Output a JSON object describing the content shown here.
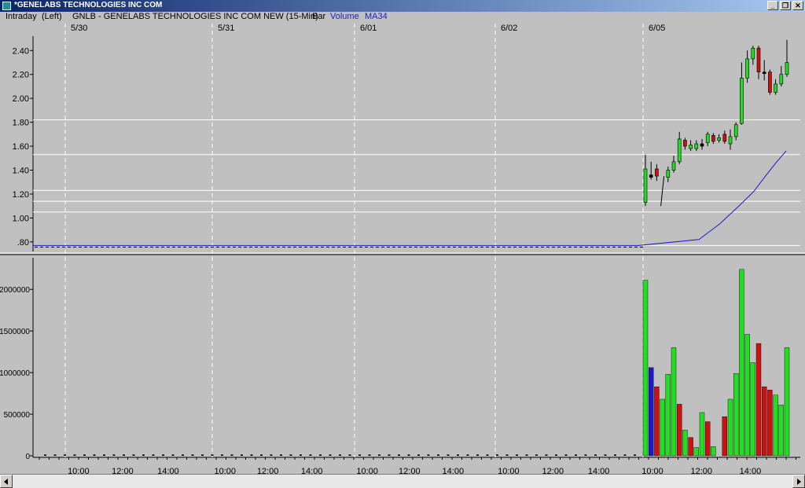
{
  "window": {
    "title": "*GENELABS TECHNOLOGIES INC COM",
    "minimize_glyph": "_",
    "restore_glyph": "❐",
    "close_glyph": "✕"
  },
  "header": {
    "mode": "Intraday",
    "axis_side": "(Left)",
    "symbol_desc": "GNLB - GENELABS TECHNOLOGIES INC COM NEW  (15-Min)",
    "chart_style": "Bar",
    "volume_label": "Volume",
    "ma_label": "MA34"
  },
  "colors": {
    "up": "#22dd22",
    "down": "#cc1111",
    "blue": "#1a1acc",
    "ma": "#1a1acc",
    "background": "#c0c0c0",
    "grid": "#ffffff"
  },
  "chart_data": [
    {
      "type": "candlestick",
      "title": "GNLB - GENELABS TECHNOLOGIES INC COM NEW  (15-Min)",
      "date_labels": [
        "5/30",
        "5/31",
        "6/01",
        "6/02",
        "6/05"
      ],
      "ylim": [
        0.72,
        2.52
      ],
      "yticks": [
        0.8,
        1.0,
        1.2,
        1.4,
        1.6,
        1.8,
        2.0,
        2.2,
        2.4
      ],
      "ytick_labels": [
        ".80",
        "1.00",
        "1.20",
        "1.40",
        "1.60",
        "1.80",
        "2.00",
        "2.20",
        "2.40"
      ],
      "horizontal_lines": [
        1.82,
        1.53,
        1.23,
        1.14,
        1.05,
        0.77
      ],
      "flat_price": 0.77,
      "candles_6_05": [
        {
          "o": 1.13,
          "h": 1.53,
          "l": 1.1,
          "c": 1.41,
          "dir": "up"
        },
        {
          "o": 1.36,
          "h": 1.47,
          "l": 1.32,
          "c": 1.34,
          "dir": "flat"
        },
        {
          "o": 1.41,
          "h": 1.45,
          "l": 1.31,
          "c": 1.35,
          "dir": "down"
        },
        {
          "o": 1.13,
          "h": 1.35,
          "l": 1.1,
          "c": 1.3,
          "dir": "line"
        },
        {
          "o": 1.34,
          "h": 1.43,
          "l": 1.3,
          "c": 1.4,
          "dir": "up"
        },
        {
          "o": 1.4,
          "h": 1.52,
          "l": 1.38,
          "c": 1.47,
          "dir": "up"
        },
        {
          "o": 1.47,
          "h": 1.72,
          "l": 1.45,
          "c": 1.66,
          "dir": "up"
        },
        {
          "o": 1.65,
          "h": 1.67,
          "l": 1.57,
          "c": 1.6,
          "dir": "down"
        },
        {
          "o": 1.58,
          "h": 1.65,
          "l": 1.56,
          "c": 1.61,
          "dir": "up"
        },
        {
          "o": 1.58,
          "h": 1.65,
          "l": 1.56,
          "c": 1.62,
          "dir": "up"
        },
        {
          "o": 1.62,
          "h": 1.66,
          "l": 1.57,
          "c": 1.6,
          "dir": "flat"
        },
        {
          "o": 1.63,
          "h": 1.72,
          "l": 1.6,
          "c": 1.7,
          "dir": "up"
        },
        {
          "o": 1.69,
          "h": 1.71,
          "l": 1.62,
          "c": 1.64,
          "dir": "down"
        },
        {
          "o": 1.65,
          "h": 1.7,
          "l": 1.63,
          "c": 1.67,
          "dir": "up"
        },
        {
          "o": 1.7,
          "h": 1.73,
          "l": 1.62,
          "c": 1.64,
          "dir": "down"
        },
        {
          "o": 1.62,
          "h": 1.74,
          "l": 1.57,
          "c": 1.68,
          "dir": "up"
        },
        {
          "o": 1.68,
          "h": 1.8,
          "l": 1.65,
          "c": 1.78,
          "dir": "up"
        },
        {
          "o": 1.79,
          "h": 2.3,
          "l": 1.78,
          "c": 2.17,
          "dir": "up"
        },
        {
          "o": 2.17,
          "h": 2.4,
          "l": 2.13,
          "c": 2.33,
          "dir": "up"
        },
        {
          "o": 2.33,
          "h": 2.44,
          "l": 2.28,
          "c": 2.42,
          "dir": "up"
        },
        {
          "o": 2.42,
          "h": 2.44,
          "l": 2.16,
          "c": 2.22,
          "dir": "down"
        },
        {
          "o": 2.22,
          "h": 2.32,
          "l": 2.15,
          "c": 2.21,
          "dir": "flat"
        },
        {
          "o": 2.22,
          "h": 2.24,
          "l": 2.03,
          "c": 2.05,
          "dir": "down"
        },
        {
          "o": 2.05,
          "h": 2.16,
          "l": 2.03,
          "c": 2.12,
          "dir": "up"
        },
        {
          "o": 2.12,
          "h": 2.27,
          "l": 2.1,
          "c": 2.2,
          "dir": "up"
        },
        {
          "o": 2.2,
          "h": 2.49,
          "l": 2.18,
          "c": 2.3,
          "dir": "up"
        }
      ],
      "ma34": [
        {
          "t": 0.0,
          "v": 0.77
        },
        {
          "t": 0.41,
          "v": 0.82
        },
        {
          "t": 0.55,
          "v": 0.95
        },
        {
          "t": 0.68,
          "v": 1.1
        },
        {
          "t": 0.78,
          "v": 1.22
        },
        {
          "t": 0.86,
          "v": 1.35
        },
        {
          "t": 0.93,
          "v": 1.46
        },
        {
          "t": 1.0,
          "v": 1.56
        }
      ],
      "series": [
        {
          "name": "Volume"
        },
        {
          "name": "MA34"
        }
      ]
    },
    {
      "type": "bar",
      "ylim": [
        0,
        2380000
      ],
      "yticks": [
        0,
        500000,
        1000000,
        1500000,
        2000000
      ],
      "ytick_labels": [
        "0",
        "500000",
        "1000000",
        "1500000",
        "2000000"
      ],
      "xtick_labels": [
        "10:00",
        "12:00",
        "14:00",
        "10:00",
        "12:00",
        "14:00",
        "10:00",
        "12:00",
        "14:00",
        "10:00",
        "12:00",
        "14:00",
        "10:00",
        "12:00",
        "14:00"
      ],
      "volumes_6_05": [
        {
          "v": 2110000,
          "c": "up"
        },
        {
          "v": 1060000,
          "c": "blue"
        },
        {
          "v": 830000,
          "c": "down"
        },
        {
          "v": 680000,
          "c": "up"
        },
        {
          "v": 980000,
          "c": "up"
        },
        {
          "v": 1300000,
          "c": "up"
        },
        {
          "v": 620000,
          "c": "down"
        },
        {
          "v": 310000,
          "c": "up"
        },
        {
          "v": 220000,
          "c": "down"
        },
        {
          "v": 100000,
          "c": "up"
        },
        {
          "v": 520000,
          "c": "up"
        },
        {
          "v": 410000,
          "c": "down"
        },
        {
          "v": 110000,
          "c": "up"
        },
        {
          "v": 0,
          "c": "up"
        },
        {
          "v": 470000,
          "c": "down"
        },
        {
          "v": 680000,
          "c": "up"
        },
        {
          "v": 990000,
          "c": "up"
        },
        {
          "v": 2240000,
          "c": "up"
        },
        {
          "v": 1460000,
          "c": "up"
        },
        {
          "v": 1120000,
          "c": "up"
        },
        {
          "v": 1350000,
          "c": "down"
        },
        {
          "v": 830000,
          "c": "down"
        },
        {
          "v": 790000,
          "c": "down"
        },
        {
          "v": 730000,
          "c": "up"
        },
        {
          "v": 610000,
          "c": "up"
        },
        {
          "v": 1300000,
          "c": "up"
        }
      ],
      "prior_days_volume": 15000
    }
  ]
}
